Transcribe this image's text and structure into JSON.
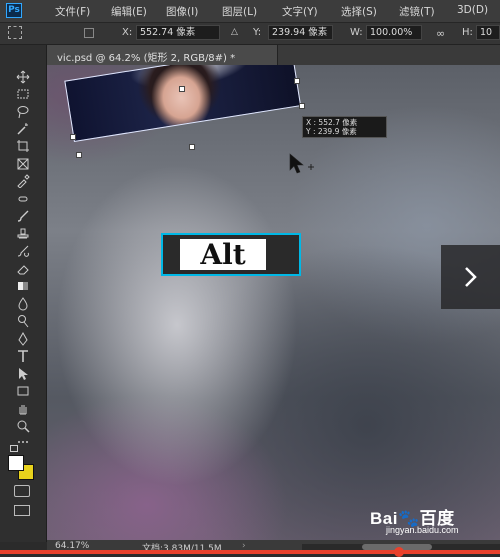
{
  "app": {
    "logo": "Ps",
    "accent": "#31a8ff"
  },
  "menu": [
    "文件(F)",
    "编辑(E)",
    "图像(I)",
    "图层(L)",
    "文字(Y)",
    "选择(S)",
    "滤镜(T)",
    "3D(D)"
  ],
  "options": {
    "x_label": "X:",
    "x_value": "552.74 像素",
    "y_label": "Y:",
    "y_value": "239.94 像素",
    "w_label": "W:",
    "w_value": "100.00%",
    "h_label": "H:",
    "h_value": "10"
  },
  "document": {
    "tab_title": "vic.psd @ 64.2% (矩形 2, RGB/8#) *"
  },
  "tooltip": {
    "x_line": "X : 552.7 像素",
    "y_line": "Y : 239.9 像素"
  },
  "overlay": {
    "key_label": "Alt",
    "key_border_color": "#00b8e6"
  },
  "status": {
    "zoom": "64.17%",
    "doc_size": "文档:3.83M/11.5M"
  },
  "watermark": {
    "brand": "Bai🐾百度",
    "sub": "jingyan.baidu.com"
  },
  "colors": {
    "foreground": "#ffffff",
    "background": "#e8d21c",
    "accent_bar": "#e8412c"
  },
  "tools": [
    "move-icon",
    "marquee-icon",
    "lasso-icon",
    "magic-wand-icon",
    "crop-icon",
    "frame-icon",
    "eyedropper-icon",
    "healing-icon",
    "brush-icon",
    "stamp-icon",
    "history-brush-icon",
    "eraser-icon",
    "gradient-icon",
    "blur-icon",
    "dodge-icon",
    "pen-icon",
    "type-icon",
    "path-select-icon",
    "rectangle-icon",
    "hand-icon",
    "zoom-icon",
    "more-icon"
  ]
}
